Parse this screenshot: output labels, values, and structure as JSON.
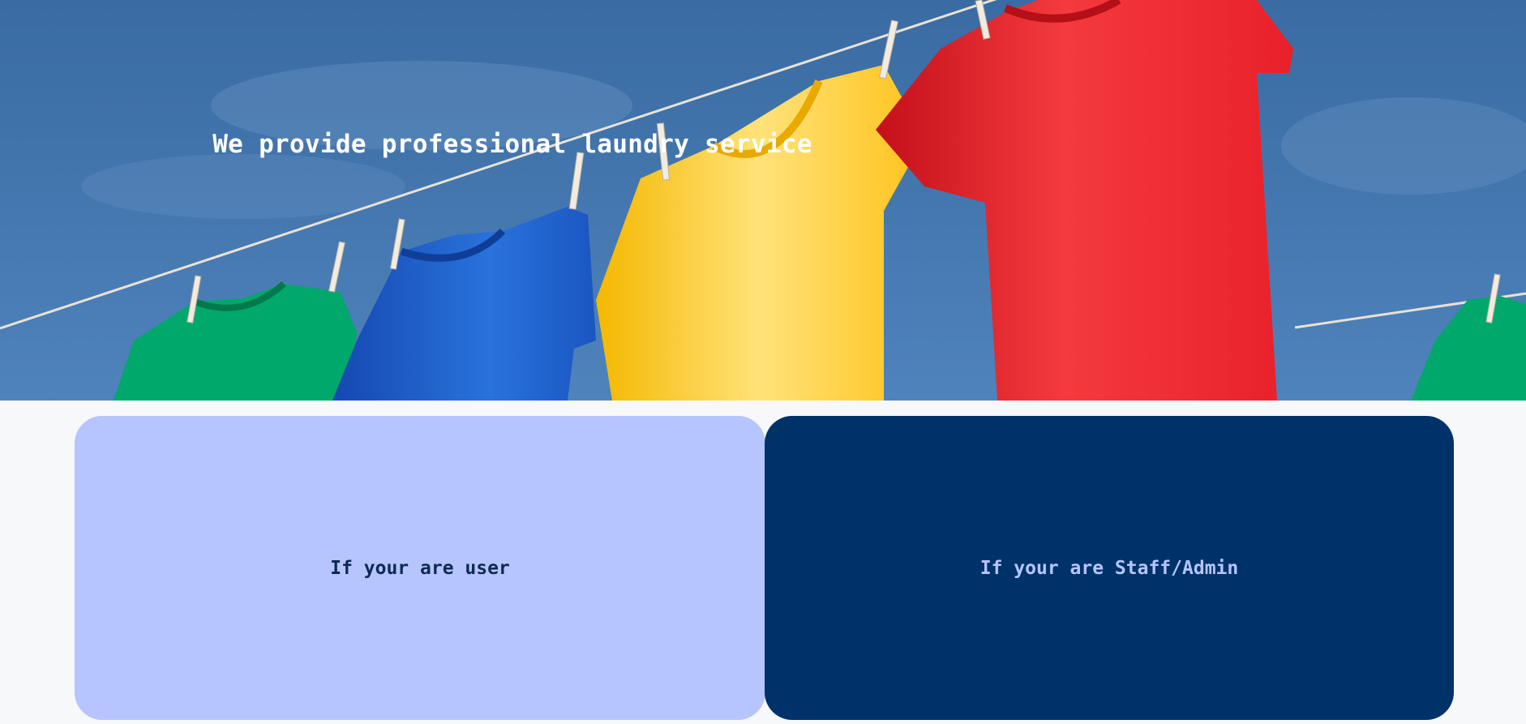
{
  "hero": {
    "title": "We provide professional laundry service",
    "image": "clothesline-tshirts"
  },
  "cards": {
    "user": {
      "label": "If your are user",
      "background": "#b6c5fd",
      "text_color": "#0d2a55"
    },
    "staff": {
      "label": "If your are Staff/Admin",
      "background": "#00326a",
      "text_color": "#b6c5fd"
    }
  },
  "colors": {
    "page_background": "#f7f8f9",
    "sky": "#3b6fa6",
    "shirt_green": "#00a86b",
    "shirt_blue": "#1e62d0",
    "shirt_yellow": "#ffd23a",
    "shirt_red": "#f0232a"
  }
}
